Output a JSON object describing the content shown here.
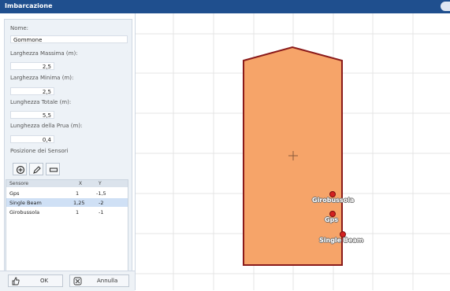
{
  "window": {
    "title": "Imbarcazione"
  },
  "form": {
    "nome_label": "Nome:",
    "nome_value": "Gommone",
    "larghezza_massima_label": "Larghezza Massima (m):",
    "larghezza_massima_value": "2,5",
    "larghezza_minima_label": "Larghezza Minima (m):",
    "larghezza_minima_value": "2,5",
    "lunghezza_totale_label": "Lunghezza Totale (m):",
    "lunghezza_totale_value": "5,5",
    "lunghezza_prua_label": "Lunghezza della Prua (m):",
    "lunghezza_prua_value": "0,4",
    "sensori_label": "Posizione dei Sensori"
  },
  "sensor_toolbar": {
    "add_icon": "add-circle-icon",
    "edit_icon": "pencil-icon",
    "remove_icon": "minus-rect-icon"
  },
  "sensor_table": {
    "columns": [
      "Sensore",
      "X",
      "Y"
    ],
    "rows": [
      {
        "name": "Gps",
        "x": "1",
        "y": "-1,5"
      },
      {
        "name": "Single Beam",
        "x": "1,25",
        "y": "-2"
      },
      {
        "name": "Girobussola",
        "x": "1",
        "y": "-1"
      }
    ]
  },
  "buttons": {
    "ok_label": "OK",
    "annulla_label": "Annulla"
  },
  "canvas": {
    "hull_color": "#f6a469",
    "hull_outline": "#8a1a1a",
    "sensor_labels": [
      "Girobussola",
      "Gps",
      "Single Beam"
    ]
  }
}
